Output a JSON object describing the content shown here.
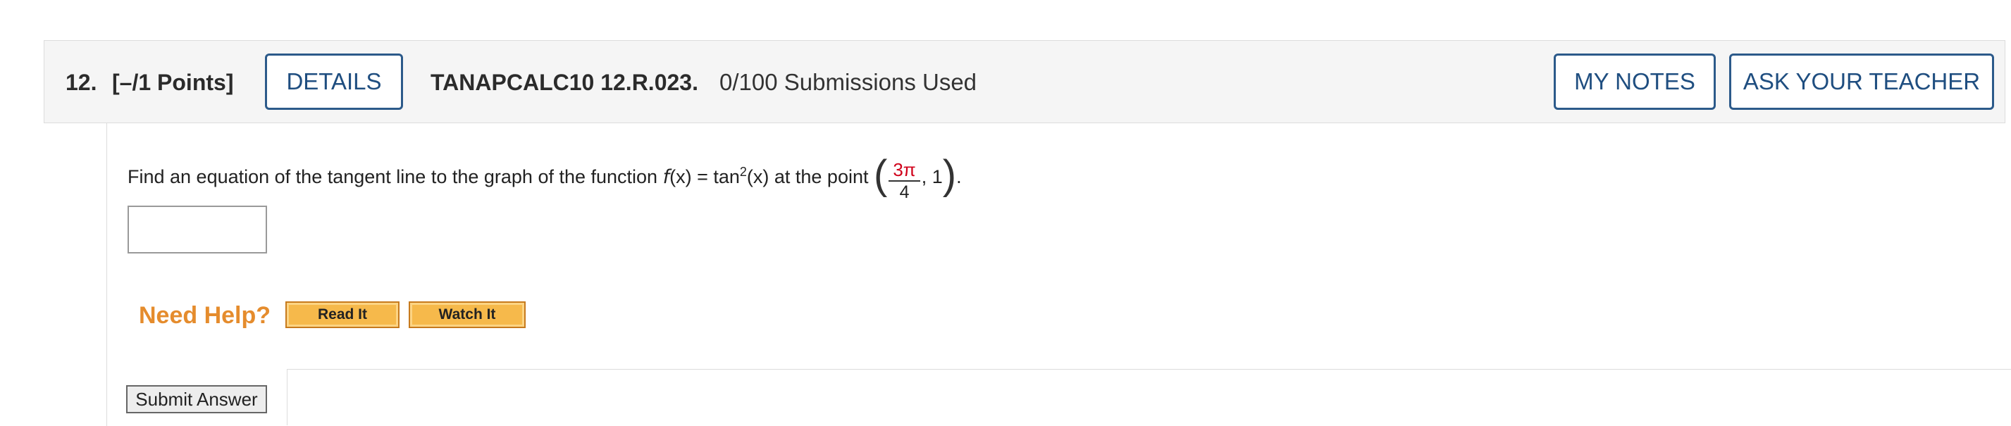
{
  "question": {
    "number": "12.",
    "points": "[–/1 Points]",
    "details_label": "DETAILS",
    "reference": "TANAPCALC10 12.R.023.",
    "submissions": "0/100 Submissions Used",
    "my_notes_label": "MY NOTES",
    "ask_teacher_label": "ASK YOUR TEACHER"
  },
  "problem": {
    "text_before": "Find an equation of the tangent line to the graph of the function ",
    "func_name": "f",
    "func_arg": "(x)",
    "equals": " = tan",
    "exponent": "2",
    "func_tail": "(x) at the point ",
    "point_left_paren": "(",
    "point_numerator": "3π",
    "point_denominator": "4",
    "point_separator": ", 1",
    "point_right_paren": ")",
    "period": "."
  },
  "answer": {
    "value": ""
  },
  "help": {
    "label": "Need Help?",
    "read_it": "Read It",
    "watch_it": "Watch It"
  },
  "submit": {
    "label": "Submit Answer"
  },
  "colors": {
    "accent_blue": "#1f4e80",
    "help_orange": "#e58c2d",
    "highlight_red": "#d0021b"
  }
}
